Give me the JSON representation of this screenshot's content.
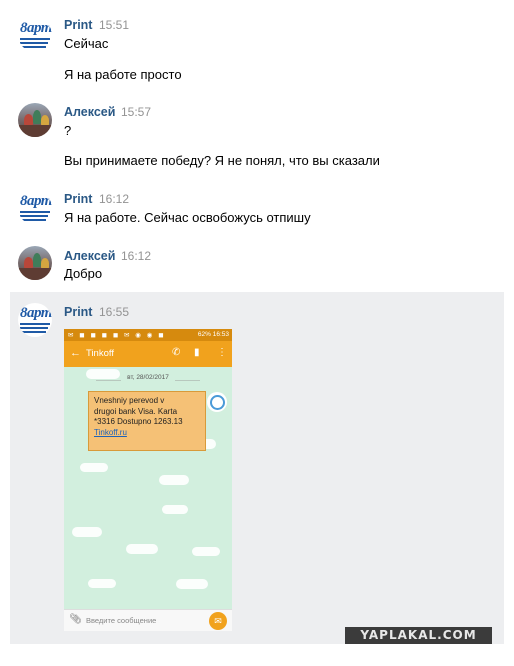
{
  "messages": [
    {
      "author": "Print",
      "time": "15:51",
      "lines": [
        "Сейчас",
        "Я на работе просто"
      ],
      "avatar": "logo-avatar"
    },
    {
      "author": "Алексей",
      "time": "15:57",
      "lines": [
        "?",
        "Вы принимаете победу? Я не понял, что вы сказали"
      ],
      "avatar": "photo-avatar"
    },
    {
      "author": "Print",
      "time": "16:12",
      "lines": [
        "Я на работе. Сейчас освобожусь отпишу"
      ],
      "avatar": "logo-avatar"
    },
    {
      "author": "Алексей",
      "time": "16:12",
      "lines": [
        "Добро"
      ],
      "avatar": "photo-avatar"
    },
    {
      "author": "Print",
      "time": "16:55",
      "attachment": "phone-screenshot",
      "avatar": "logo-avatar"
    }
  ],
  "logo": {
    "text": "8арт"
  },
  "phone": {
    "status_time": "16:53",
    "battery": "62%",
    "app_title": "Tinkoff",
    "date_label": "вт, 28/02/2017",
    "sms_lines": [
      "Vneshniy perevod v",
      "drugoi bank Visa. Karta",
      "*3316 Dostupno 1263.13"
    ],
    "sms_link": "Tinkoff.ru",
    "input_placeholder": "Введите сообщение"
  },
  "watermark": "YAPLAKAL.COM",
  "colors": {
    "name": "#2a5885",
    "time": "#939393",
    "highlight": "#edeef0",
    "tinkoff": "#f1a21d",
    "bubble": "#f5c176"
  }
}
